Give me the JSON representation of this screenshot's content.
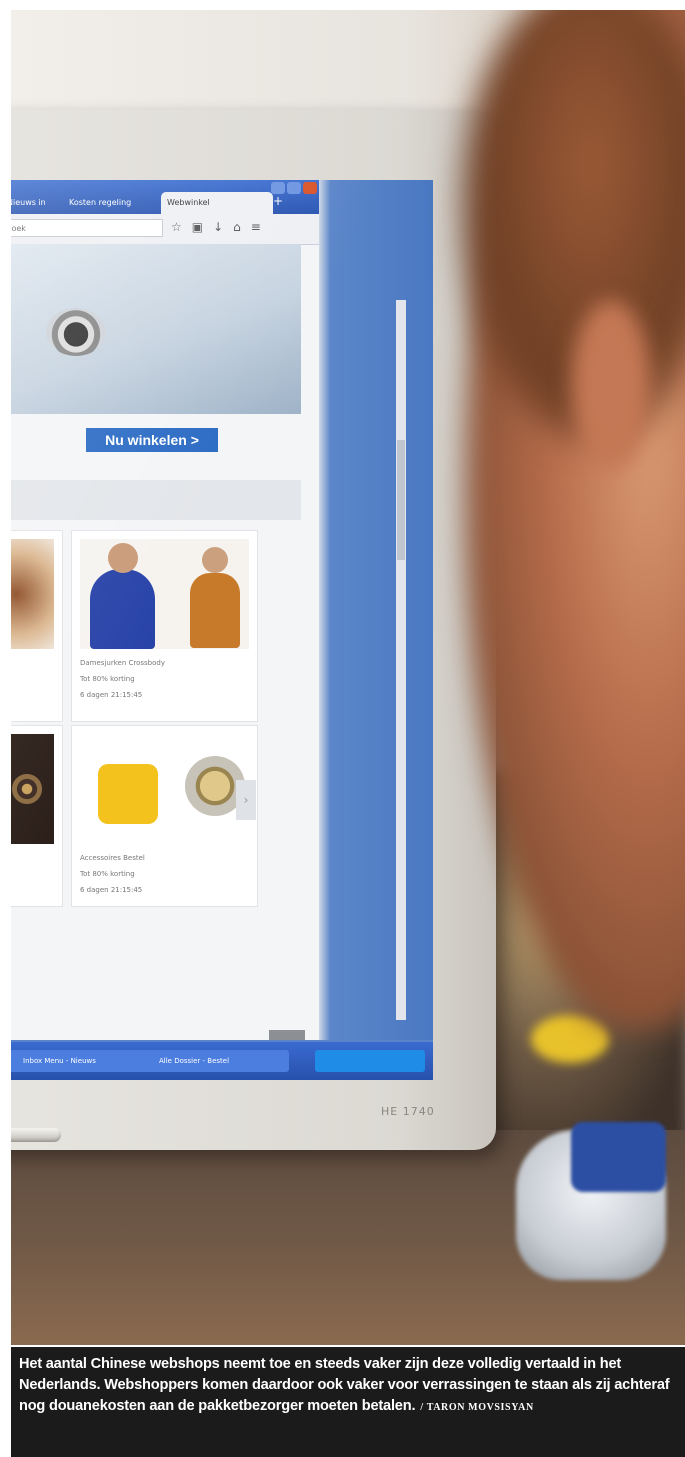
{
  "photo": {
    "description_icon": "photo-image",
    "screen": {
      "tabs": [
        "Nieuws in",
        "Kosten regeling",
        "Webwinkel"
      ],
      "url_placeholder": "Zoek",
      "shop_button_label": "Nu winkelen >",
      "products": [
        {
          "line1": "Damesjurken Crossbody",
          "line2": "Tot 80% korting",
          "line3": "6 dagen 21:15:45"
        },
        {
          "line1": "Accessoires Bestel",
          "line2": "Tot 80% korting",
          "line3": "6 dagen 21:15:45"
        }
      ],
      "taskbar": [
        "Inbox Menu - Nieuws",
        "Alle Dossier - Bestel"
      ],
      "monitor_brand": "HE 1740"
    },
    "colors": {
      "taskbar": "#2a55b1",
      "shop_button": "#2b6bc4",
      "caption_bg": "#1b1b1b"
    }
  },
  "caption": {
    "text": "Het aantal Chinese webshops neemt toe en steeds vaker zijn deze volledig vertaald in het Nederlands. Webshoppers komen daardoor ook vaker voor verrassingen te staan als zij achteraf nog douanekosten aan de pakketbezorger moeten betalen.",
    "credit": "/ TARON MOVSISYAN"
  }
}
